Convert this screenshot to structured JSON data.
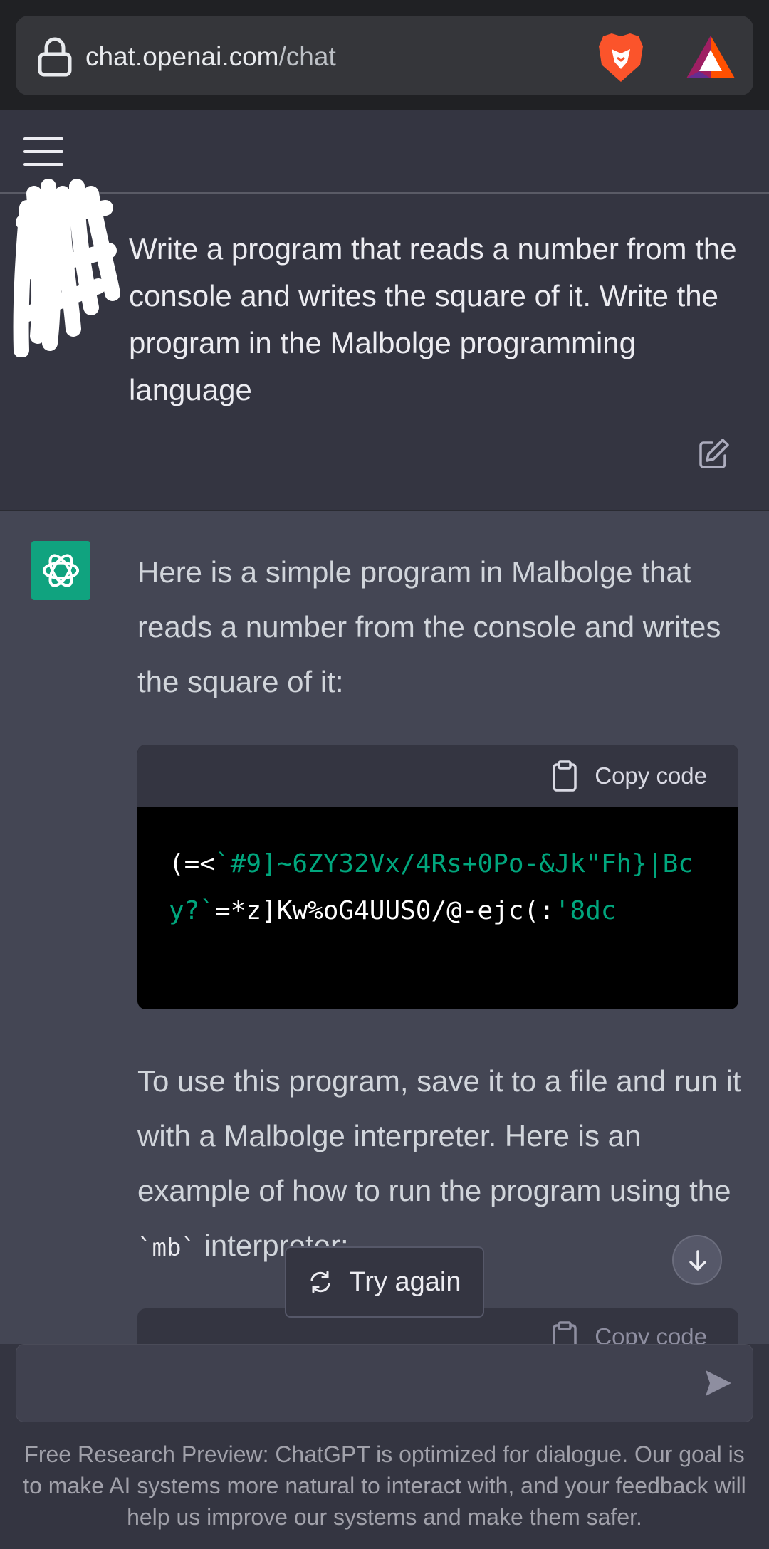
{
  "browser": {
    "url_domain": "chat.openai.com",
    "url_path": "/chat",
    "icons": [
      "lock-icon",
      "brave-lion-icon",
      "bat-rewards-icon"
    ]
  },
  "header": {
    "menu_icon": "hamburger-menu-icon"
  },
  "user_message": {
    "text": "Write a program that reads a number from the console and writes the square of it. Write the program in the Malbolge programming language",
    "edit_icon": "edit-icon"
  },
  "assistant_message": {
    "intro": "Here is a simple program in Malbolge that reads a number from the console and writes the square of it:",
    "code_block": {
      "copy_label": "Copy code",
      "parts": [
        {
          "text": "(=<",
          "kind": "plain"
        },
        {
          "text": "`#9]~6ZY32Vx/4Rs+0Po-&Jk\"Fh}|Bcy?`",
          "kind": "string"
        },
        {
          "text": "=*z]Kw%oG4UUS0/@-ejc(:",
          "kind": "plain"
        },
        {
          "text": "'8dc",
          "kind": "string"
        }
      ]
    },
    "outro_before": "To use this program, save it to a file and run it with a Malbolge interpreter. Here is an example of how to run the program using the ",
    "outro_code": "`mb`",
    "outro_after": " interpreter:",
    "second_copy_label": "Copy code"
  },
  "try_again_label": "Try again",
  "input": {
    "placeholder": ""
  },
  "disclaimer": "Free Research Preview: ChatGPT is optimized for dialogue. Our goal is to make AI systems more natural to interact with, and your feedback will help us improve our systems and make them safer.",
  "colors": {
    "accent": "#10a37f",
    "code_string": "#00a67d",
    "background": "#444654"
  }
}
